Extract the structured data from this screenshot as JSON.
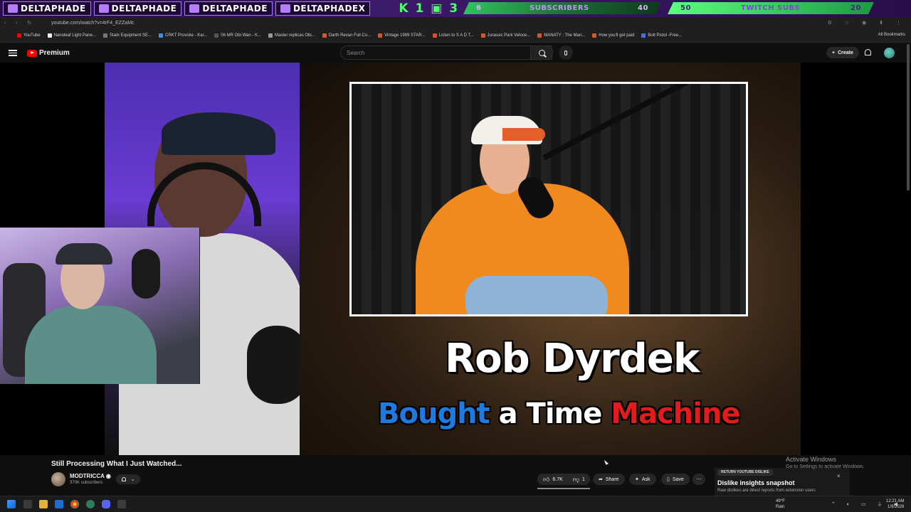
{
  "overlay": {
    "socials": [
      "DELTAPHADE",
      "DELTAPHADE",
      "DELTAPHADE",
      "DELTAPHADEX"
    ],
    "k_counter": "K 1",
    "flag_counter": "3",
    "subscribers": {
      "current": "6",
      "label": "SUBSCRIBERS",
      "goal": "40"
    },
    "twitch": {
      "current": "50",
      "label": "TWITCH SUBS",
      "goal": "20"
    }
  },
  "browser": {
    "url": "youtube.com/watch?v=4rF4_EZZaMc",
    "bookmarks": [
      "YouTube",
      "Nanoleaf Light Pane...",
      "Stark Equipment SE...",
      "CRKT Provoke - Kar...",
      "06 MR Obi Wan - K...",
      "Master replicas Obi...",
      "Darth Revan Full Co...",
      "Vintage 1999 STAR...",
      "Listen to S A D T...",
      "Jurassic Park Veloce...",
      "MANATY : The Man...",
      "How you'll get paid",
      "Bolt Pistol -Free..."
    ],
    "all_bookmarks": "All Bookmarks"
  },
  "header": {
    "logo_text": "Premium",
    "search_placeholder": "Search",
    "create_label": "Create"
  },
  "video": {
    "thumbnail_title": "Rob Dyrdek",
    "thumbnail_sub": [
      "Bought",
      "a Time",
      "Machine"
    ]
  },
  "meta": {
    "title": "Still Processing What I Just Watched...",
    "channel": "MODTRICCA",
    "subscribers": "370K subscribers",
    "likes": "6.7K",
    "dislikes": "1",
    "share": "Share",
    "ask": "Ask",
    "save": "Save"
  },
  "popup": {
    "button": "RETURN YOUTUBE DISLIKE",
    "title": "Dislike insights snapshot",
    "desc": "Raw dislikes are direct reports from extension users"
  },
  "activate": {
    "title": "Activate Windows",
    "sub": "Go to Settings to activate Windows."
  },
  "taskbar": {
    "temp": "49°F",
    "weather": "Rain",
    "time": "12:21 AM",
    "date": "1/9/2026"
  }
}
